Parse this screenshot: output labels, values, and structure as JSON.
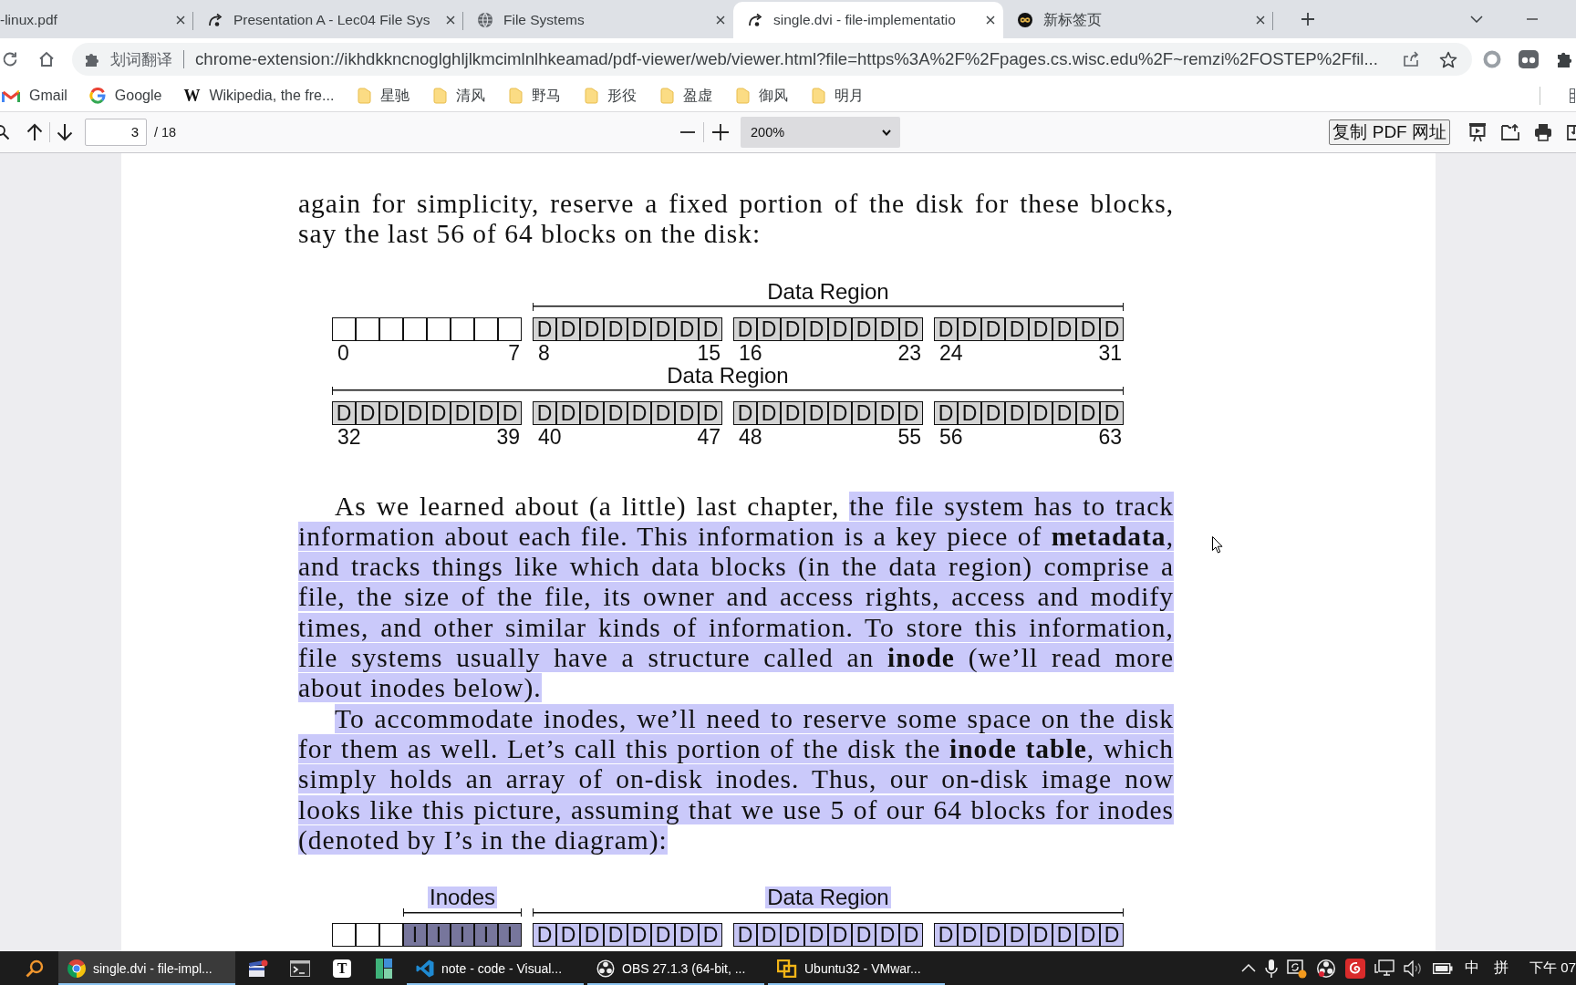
{
  "tabs": [
    {
      "title": "-linux.pdf",
      "kind": "plain",
      "selected": false
    },
    {
      "title": "Presentation A - Lec04 File Sys",
      "kind": "translator",
      "selected": false
    },
    {
      "title": "File Systems",
      "kind": "web",
      "selected": false
    },
    {
      "title": "single.dvi - file-implementatio",
      "kind": "translator",
      "selected": true
    },
    {
      "title": "新标签页",
      "kind": "newtab",
      "selected": false
    }
  ],
  "address_bar": {
    "extension_label": "划词翻译",
    "url": "chrome-extension://ikhdkkncnoglghljlkmcimlnlhkeamad/pdf-viewer/web/viewer.html?file=https%3A%2F%2Fpages.cs.wisc.edu%2F~remzi%2FOSTEP%2Ffil..."
  },
  "bookmarks": [
    {
      "label": "Gmail",
      "kind": "gmail"
    },
    {
      "label": "Google",
      "kind": "google"
    },
    {
      "label": "Wikipedia, the fre...",
      "kind": "glyph",
      "glyph": "W"
    },
    {
      "label": "星驰",
      "kind": "folder"
    },
    {
      "label": "清风",
      "kind": "folder"
    },
    {
      "label": "野马",
      "kind": "folder"
    },
    {
      "label": "形役",
      "kind": "folder"
    },
    {
      "label": "盈虚",
      "kind": "folder"
    },
    {
      "label": "御风",
      "kind": "folder"
    },
    {
      "label": "明月",
      "kind": "folder"
    }
  ],
  "pdf_toolbar": {
    "page": "3",
    "page_count": "/ 18",
    "zoom": "200%",
    "copy_button": "复制 PDF 网址"
  },
  "document": [
    {
      "kind": "paragraph",
      "indent": false,
      "segments": [
        {
          "text": "again for simplicity, reserve a fixed portion of the disk for these blocks, say the last 56 of 64 blocks on the disk:",
          "selected": false
        }
      ]
    },
    {
      "kind": "figure",
      "selected": false,
      "rows": [
        {
          "segments": [
            {
              "groups": [
                {
                  "start": "0",
                  "end": "7",
                  "cells": [
                    {
                      "kind": "empty"
                    },
                    {
                      "kind": "empty"
                    },
                    {
                      "kind": "empty"
                    },
                    {
                      "kind": "empty"
                    },
                    {
                      "kind": "empty"
                    },
                    {
                      "kind": "empty"
                    },
                    {
                      "kind": "empty"
                    },
                    {
                      "kind": "empty"
                    }
                  ]
                }
              ]
            },
            {
              "label": "Data Region",
              "joined": false,
              "groups": [
                {
                  "start": "8",
                  "end": "15",
                  "cells": [
                    {
                      "kind": "data",
                      "label": "D"
                    },
                    {
                      "kind": "data",
                      "label": "D"
                    },
                    {
                      "kind": "data",
                      "label": "D"
                    },
                    {
                      "kind": "data",
                      "label": "D"
                    },
                    {
                      "kind": "data",
                      "label": "D"
                    },
                    {
                      "kind": "data",
                      "label": "D"
                    },
                    {
                      "kind": "data",
                      "label": "D"
                    },
                    {
                      "kind": "data",
                      "label": "D"
                    }
                  ]
                },
                {
                  "start": "16",
                  "end": "23",
                  "cells": [
                    {
                      "kind": "data",
                      "label": "D"
                    },
                    {
                      "kind": "data",
                      "label": "D"
                    },
                    {
                      "kind": "data",
                      "label": "D"
                    },
                    {
                      "kind": "data",
                      "label": "D"
                    },
                    {
                      "kind": "data",
                      "label": "D"
                    },
                    {
                      "kind": "data",
                      "label": "D"
                    },
                    {
                      "kind": "data",
                      "label": "D"
                    },
                    {
                      "kind": "data",
                      "label": "D"
                    }
                  ]
                },
                {
                  "start": "24",
                  "end": "31",
                  "cells": [
                    {
                      "kind": "data",
                      "label": "D"
                    },
                    {
                      "kind": "data",
                      "label": "D"
                    },
                    {
                      "kind": "data",
                      "label": "D"
                    },
                    {
                      "kind": "data",
                      "label": "D"
                    },
                    {
                      "kind": "data",
                      "label": "D"
                    },
                    {
                      "kind": "data",
                      "label": "D"
                    },
                    {
                      "kind": "data",
                      "label": "D"
                    },
                    {
                      "kind": "data",
                      "label": "D"
                    }
                  ]
                }
              ]
            }
          ]
        },
        {
          "segments": [
            {
              "label": "Data Region",
              "groups": [
                {
                  "start": "32",
                  "end": "39",
                  "cells": [
                    {
                      "kind": "data",
                      "label": "D"
                    },
                    {
                      "kind": "data",
                      "label": "D"
                    },
                    {
                      "kind": "data",
                      "label": "D"
                    },
                    {
                      "kind": "data",
                      "label": "D"
                    },
                    {
                      "kind": "data",
                      "label": "D"
                    },
                    {
                      "kind": "data",
                      "label": "D"
                    },
                    {
                      "kind": "data",
                      "label": "D"
                    },
                    {
                      "kind": "data",
                      "label": "D"
                    }
                  ]
                },
                {
                  "start": "40",
                  "end": "47",
                  "cells": [
                    {
                      "kind": "data",
                      "label": "D"
                    },
                    {
                      "kind": "data",
                      "label": "D"
                    },
                    {
                      "kind": "data",
                      "label": "D"
                    },
                    {
                      "kind": "data",
                      "label": "D"
                    },
                    {
                      "kind": "data",
                      "label": "D"
                    },
                    {
                      "kind": "data",
                      "label": "D"
                    },
                    {
                      "kind": "data",
                      "label": "D"
                    },
                    {
                      "kind": "data",
                      "label": "D"
                    }
                  ]
                },
                {
                  "start": "48",
                  "end": "55",
                  "cells": [
                    {
                      "kind": "data",
                      "label": "D"
                    },
                    {
                      "kind": "data",
                      "label": "D"
                    },
                    {
                      "kind": "data",
                      "label": "D"
                    },
                    {
                      "kind": "data",
                      "label": "D"
                    },
                    {
                      "kind": "data",
                      "label": "D"
                    },
                    {
                      "kind": "data",
                      "label": "D"
                    },
                    {
                      "kind": "data",
                      "label": "D"
                    },
                    {
                      "kind": "data",
                      "label": "D"
                    }
                  ]
                },
                {
                  "start": "56",
                  "end": "63",
                  "cells": [
                    {
                      "kind": "data",
                      "label": "D"
                    },
                    {
                      "kind": "data",
                      "label": "D"
                    },
                    {
                      "kind": "data",
                      "label": "D"
                    },
                    {
                      "kind": "data",
                      "label": "D"
                    },
                    {
                      "kind": "data",
                      "label": "D"
                    },
                    {
                      "kind": "data",
                      "label": "D"
                    },
                    {
                      "kind": "data",
                      "label": "D"
                    },
                    {
                      "kind": "data",
                      "label": "D"
                    }
                  ]
                }
              ]
            }
          ]
        }
      ]
    },
    {
      "kind": "paragraph",
      "indent": true,
      "segments": [
        {
          "text": "As we learned about (a little) last chapter, ",
          "selected": false
        },
        {
          "text": "the file system has to track information about each file. This information is a key piece of **metadata**, and tracks things like which data blocks (in the data region) comprise a file, the size of the file, its owner and access rights, access and modify times, and other similar kinds of information. To store this information, file systems usually have a structure called an **inode** (we’ll read more about inodes below).",
          "selected": true
        }
      ]
    },
    {
      "kind": "paragraph",
      "indent": true,
      "segments": [
        {
          "text": "To accommodate inodes, we’ll need to reserve some space on the disk for them as well. Let’s call this portion of the disk the **inode table**, which simply holds an array of on-disk inodes. Thus, our on-disk image now looks like this picture, assuming that we use 5 of our 64 blocks for inodes (denoted by I’s in the diagram):",
          "selected": true
        }
      ]
    },
    {
      "kind": "figure",
      "selected": true,
      "rows": [
        {
          "segments": [
            {
              "groups": [
                {
                  "cells": [
                    {
                      "kind": "empty"
                    },
                    {
                      "kind": "empty"
                    },
                    {
                      "kind": "empty"
                    }
                  ]
                }
              ]
            },
            {
              "label": "Inodes",
              "joined": true,
              "groups": [
                {
                  "cells": [
                    {
                      "kind": "inode",
                      "label": "I"
                    },
                    {
                      "kind": "inode",
                      "label": "I"
                    },
                    {
                      "kind": "inode",
                      "label": "I"
                    },
                    {
                      "kind": "inode",
                      "label": "I"
                    },
                    {
                      "kind": "inode",
                      "label": "I"
                    }
                  ]
                }
              ]
            },
            {
              "label": "Data Region",
              "joined": false,
              "groups": [
                {
                  "cells": [
                    {
                      "kind": "data",
                      "label": "D"
                    },
                    {
                      "kind": "data",
                      "label": "D"
                    },
                    {
                      "kind": "data",
                      "label": "D"
                    },
                    {
                      "kind": "data",
                      "label": "D"
                    },
                    {
                      "kind": "data",
                      "label": "D"
                    },
                    {
                      "kind": "data",
                      "label": "D"
                    },
                    {
                      "kind": "data",
                      "label": "D"
                    },
                    {
                      "kind": "data",
                      "label": "D"
                    }
                  ]
                },
                {
                  "cells": [
                    {
                      "kind": "data",
                      "label": "D"
                    },
                    {
                      "kind": "data",
                      "label": "D"
                    },
                    {
                      "kind": "data",
                      "label": "D"
                    },
                    {
                      "kind": "data",
                      "label": "D"
                    },
                    {
                      "kind": "data",
                      "label": "D"
                    },
                    {
                      "kind": "data",
                      "label": "D"
                    },
                    {
                      "kind": "data",
                      "label": "D"
                    },
                    {
                      "kind": "data",
                      "label": "D"
                    }
                  ]
                },
                {
                  "cells": [
                    {
                      "kind": "data",
                      "label": "D"
                    },
                    {
                      "kind": "data",
                      "label": "D"
                    },
                    {
                      "kind": "data",
                      "label": "D"
                    },
                    {
                      "kind": "data",
                      "label": "D"
                    },
                    {
                      "kind": "data",
                      "label": "D"
                    },
                    {
                      "kind": "data",
                      "label": "D"
                    },
                    {
                      "kind": "data",
                      "label": "D"
                    },
                    {
                      "kind": "data",
                      "label": "D"
                    }
                  ]
                }
              ]
            }
          ]
        }
      ]
    }
  ],
  "taskbar": {
    "apps": [
      {
        "kind": "chrome",
        "label": "single.dvi - file-impl...",
        "running": true,
        "selected": true
      },
      {
        "kind": "clapper",
        "running": false,
        "selected": false
      },
      {
        "kind": "terminal",
        "running": false,
        "selected": false
      },
      {
        "kind": "glyph",
        "glyph": "T",
        "running": false,
        "selected": false
      },
      {
        "kind": "tiles",
        "running": false,
        "selected": false
      },
      {
        "kind": "vscode",
        "label": "note - code - Visual...",
        "running": true,
        "selected": false
      },
      {
        "kind": "obs",
        "label": "OBS 27.1.3 (64-bit, ...",
        "running": true,
        "selected": false
      },
      {
        "kind": "vmware",
        "label": "Ubuntu32 - VMwar...",
        "running": true,
        "selected": false
      }
    ],
    "tray": {
      "ime": "中",
      "ime_mode": "拼",
      "clock": "下午 07"
    }
  }
}
